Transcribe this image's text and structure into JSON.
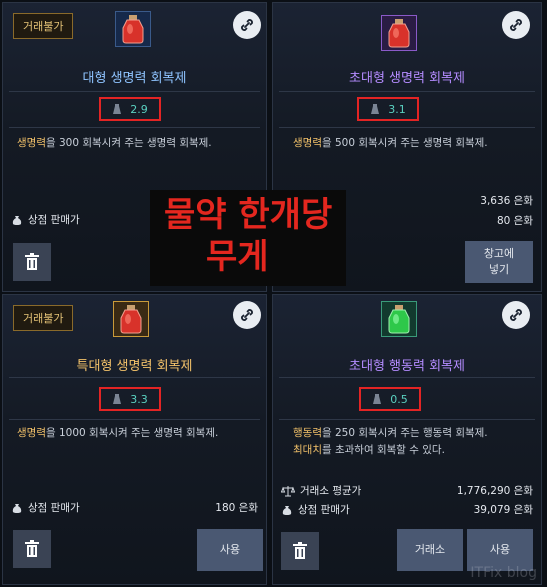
{
  "items": [
    {
      "tag": "거래불가",
      "title": "대형 생명력 회복제",
      "weight": "2.9",
      "desc_parts": [
        "생명력",
        "을 300 회복시켜 주는 생명력 회복제."
      ],
      "rows": [
        {
          "label": "상점 판매가",
          "value": ""
        }
      ],
      "buttons": []
    },
    {
      "tag": "",
      "title": "초대형 생명력 회복제",
      "weight": "3.1",
      "desc_parts": [
        "생명력",
        "을 500 회복시켜 주는 생명력 회복제."
      ],
      "rows": [
        {
          "label": "",
          "value": "3,636 은화"
        },
        {
          "label": "",
          "value": "80 은화"
        }
      ],
      "buttons": [
        "창고에\n넣기"
      ]
    },
    {
      "tag": "거래불가",
      "title": "특대형 생명력 회복제",
      "weight": "3.3",
      "desc_parts": [
        "생명력",
        "을 1000 회복시켜 주는 생명력 회복제."
      ],
      "rows": [
        {
          "label": "상점 판매가",
          "value": "180 은화"
        }
      ],
      "buttons": [
        "사용"
      ]
    },
    {
      "tag": "",
      "title": "초대형 행동력 회복제",
      "weight": "0.5",
      "desc_parts": [
        "행동력",
        "을 250 회복시켜 주는 행동력 회복제.",
        "최대치",
        "를 초과하여 회복할 수 있다."
      ],
      "rows": [
        {
          "label": "거래소 평균가",
          "value": "1,776,290 은화"
        },
        {
          "label": "상점 판매가",
          "value": "39,079 은화"
        }
      ],
      "buttons": [
        "거래소",
        "사용"
      ]
    }
  ],
  "overlay": {
    "line1": "물약 한개당",
    "line2": "무게"
  },
  "watermark": "ITFix blog",
  "colors": {
    "accent_red": "#e32424",
    "title_blue": "#8fc4ff",
    "title_orange": "#f3c26a",
    "title_purple": "#b48cff",
    "weight_teal": "#5ad0c0"
  }
}
